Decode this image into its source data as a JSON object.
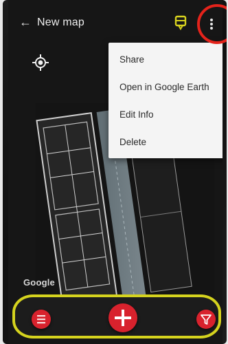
{
  "appbar": {
    "back_icon": "arrow-left-icon",
    "title": "New map",
    "layer_icon": "layers-icon",
    "overflow_icon": "more-vertical-icon"
  },
  "map": {
    "my_location_icon": "crosshair-icon",
    "attribution": "Google"
  },
  "menu": {
    "items": [
      {
        "label": "Share"
      },
      {
        "label": "Open in Google Earth"
      },
      {
        "label": "Edit Info"
      },
      {
        "label": "Delete"
      }
    ]
  },
  "bottom_bar": {
    "list_icon": "list-icon",
    "add_icon": "plus-icon",
    "filter_icon": "filter-icon"
  },
  "colors": {
    "accent_red": "#d8222d",
    "highlight_yellow": "#d5d31e",
    "highlight_circle_red": "#e4231b",
    "menu_bg": "#f4f4f4"
  }
}
